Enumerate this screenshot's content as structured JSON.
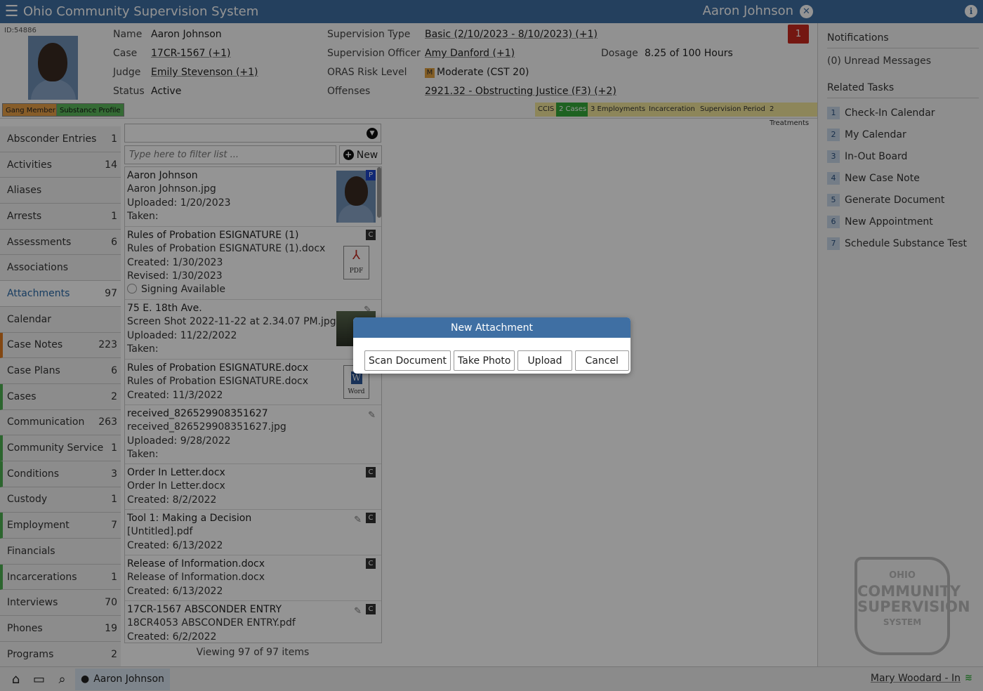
{
  "topbar": {
    "app_title": "Ohio Community Supervision System",
    "client_name": "Aaron Johnson",
    "close_glyph": "✕",
    "info_glyph": "i",
    "menu_icon": "hamburger-menu-icon"
  },
  "header": {
    "id_label": "ID:54886",
    "name_label": "Name",
    "name_value": "Aaron Johnson",
    "case_label": "Case",
    "case_value": "17CR-1567 (+1)",
    "judge_label": "Judge",
    "judge_value": "Emily Stevenson (+1)",
    "status_label": "Status",
    "status_value": "Active",
    "sup_type_label": "Supervision Type",
    "sup_type_value": "Basic (2/10/2023 - 8/10/2023) (+1)",
    "sup_officer_label": "Supervision Officer",
    "sup_officer_value": "Amy Danford (+1)",
    "oras_label": "ORAS Risk Level",
    "oras_badge": "M",
    "oras_value": "Moderate (CST 20)",
    "offenses_label": "Offenses",
    "offenses_value": "2921.32 - Obstructing Justice (F3) (+2)",
    "dosage_label": "Dosage",
    "dosage_value": "8.25 of 100 Hours",
    "notification_count": "1",
    "tags": [
      "Gang Member",
      "Substance Profile"
    ],
    "program_tags": [
      "CCIS",
      "2 Cases",
      "3 Employments",
      "Incarceration",
      "Supervision Period",
      "2 Treatments"
    ]
  },
  "sidebar": {
    "items": [
      {
        "label": "Absconder Entries",
        "count": "1"
      },
      {
        "label": "Activities",
        "count": "14"
      },
      {
        "label": "Aliases",
        "count": ""
      },
      {
        "label": "Arrests",
        "count": "1"
      },
      {
        "label": "Assessments",
        "count": "6"
      },
      {
        "label": "Associations",
        "count": ""
      },
      {
        "label": "Attachments",
        "count": "97"
      },
      {
        "label": "Calendar",
        "count": ""
      },
      {
        "label": "Case Notes",
        "count": "223"
      },
      {
        "label": "Case Plans",
        "count": "6"
      },
      {
        "label": "Cases",
        "count": "2"
      },
      {
        "label": "Communication",
        "count": "263"
      },
      {
        "label": "Community Service",
        "count": "1"
      },
      {
        "label": "Conditions",
        "count": "3"
      },
      {
        "label": "Custody",
        "count": "1"
      },
      {
        "label": "Employment",
        "count": "7"
      },
      {
        "label": "Financials",
        "count": ""
      },
      {
        "label": "Incarcerations",
        "count": "1"
      },
      {
        "label": "Interviews",
        "count": "70"
      },
      {
        "label": "Phones",
        "count": "19"
      },
      {
        "label": "Programs",
        "count": "2"
      }
    ]
  },
  "attachments": {
    "filter_placeholder": "Type here to filter list ...",
    "new_label": "New",
    "viewing": "Viewing 97 of 97 items",
    "items": [
      {
        "title": "Aaron Johnson",
        "l1": "Aaron Johnson.jpg",
        "l2": "Uploaded: 1/20/2023",
        "l3": "Taken:",
        "badge": "P"
      },
      {
        "title": "Rules of Probation ESIGNATURE (1)",
        "l1": "Rules of Probation ESIGNATURE (1).docx",
        "l2": "Created: 1/30/2023",
        "l3": "Revised: 1/30/2023",
        "l4": "Signing Available",
        "badge": "C",
        "doc": "PDF"
      },
      {
        "title": "75 E. 18th Ave.",
        "l1": "Screen Shot 2022-11-22 at 2.34.07 PM.jpg",
        "l2": "Uploaded: 11/22/2022",
        "l3": "Taken:"
      },
      {
        "title": "Rules of Probation ESIGNATURE.docx",
        "l1": "Rules of Probation ESIGNATURE.docx",
        "l2": "Created: 11/3/2022",
        "doc": "Word",
        "doc_mark": "W"
      },
      {
        "title": "received_826529908351627",
        "l1": "received_826529908351627.jpg",
        "l2": "Uploaded: 9/28/2022",
        "l3": "Taken:"
      },
      {
        "title": "Order In Letter.docx",
        "l1": "Order In Letter.docx",
        "l2": "Created: 8/2/2022",
        "badge": "C"
      },
      {
        "title": "Tool 1: Making a Decision",
        "l1": "[Untitled].pdf",
        "l2": "Created: 6/13/2022",
        "badge": "C"
      },
      {
        "title": "Release of Information.docx",
        "l1": "Release of Information.docx",
        "l2": "Created: 6/13/2022",
        "badge": "C"
      },
      {
        "title": "17CR-1567 ABSCONDER ENTRY",
        "l1": "18CR4053 ABSCONDER ENTRY.pdf",
        "l2": "Created: 6/2/2022",
        "badge": "C"
      }
    ]
  },
  "rightbar": {
    "notifications_title": "Notifications",
    "unread": "(0) Unread Messages",
    "related_title": "Related Tasks",
    "tasks": [
      {
        "num": "1",
        "label": "Check-In Calendar"
      },
      {
        "num": "2",
        "label": "My Calendar"
      },
      {
        "num": "3",
        "label": "In-Out Board"
      },
      {
        "num": "4",
        "label": "New Case Note"
      },
      {
        "num": "5",
        "label": "Generate Document"
      },
      {
        "num": "6",
        "label": "New Appointment"
      },
      {
        "num": "7",
        "label": "Schedule Substance Test"
      }
    ],
    "watermark": {
      "w1": "OHIO",
      "w2": "COMMUNITY",
      "w3": "SUPERVISION",
      "w4": "SYSTEM"
    }
  },
  "bottombar": {
    "tab_label": "Aaron Johnson",
    "user_status": "Mary Woodard - In"
  },
  "modal": {
    "title": "New Attachment",
    "scan": "Scan Document",
    "photo": "Take Photo",
    "upload": "Upload",
    "cancel": "Cancel"
  },
  "colors": {
    "brand_blue": "#3f6fa3",
    "alert_red": "#c8281e",
    "accent_green": "#4caf50",
    "accent_orange": "#e07a20"
  }
}
